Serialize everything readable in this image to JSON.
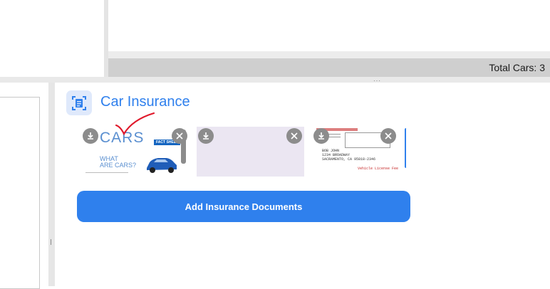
{
  "status_bar": {
    "total_cars": "Total Cars: 3"
  },
  "insurance": {
    "title": "Car Insurance",
    "add_button": "Add Insurance Documents",
    "documents": [
      {
        "kind": "fact-sheet",
        "brand": "CARS",
        "badge": "FACT SHEET",
        "subtitle_1": "WHAT",
        "subtitle_2": "ARE CARS?"
      },
      {
        "kind": "blank"
      },
      {
        "kind": "license",
        "name_line": "BOB JOHN",
        "addr_line_1": "1234 BROADWAY",
        "addr_line_2": "SACRAMENTO, CA 95818-2346",
        "stamp": "Vehicle License Fee"
      }
    ]
  },
  "colors": {
    "accent": "#2f80ed",
    "status_bar": "#cfcfcf",
    "icon_bg": "#dfe9fb",
    "blank_doc": "#ebe6f2",
    "check": "#e0192b"
  },
  "icons": [
    "document-scan-icon",
    "download-icon",
    "close-icon",
    "checkmark-annotation"
  ]
}
